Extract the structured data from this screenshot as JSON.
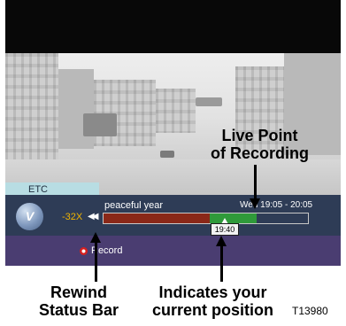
{
  "info_bar": {
    "tab_label": "ETC",
    "channel_logo_letter": "V",
    "speed": "-32X",
    "rewind_icon": "rewind-icon",
    "program_title": "peaceful year",
    "program_time": "Wed 19:05 - 20:05",
    "current_time": "19:40",
    "record_label": "Record",
    "progress": {
      "rewind_fraction": 0.52,
      "current_position_fraction": 0.56,
      "live_point_fraction": 0.75
    },
    "colors": {
      "rewind_bar": "#8a2818",
      "recorded_bar": "#2f9a3a",
      "speed_text": "#f0b400",
      "info_bar_bg": "#2e3c56"
    }
  },
  "callouts": {
    "live_line1": "Live Point",
    "live_line2": "of Recording",
    "rewind_line1": "Rewind",
    "rewind_line2": "Status Bar",
    "current_line1": "Indicates your",
    "current_line2": "current position"
  },
  "figure_code": "T13980"
}
